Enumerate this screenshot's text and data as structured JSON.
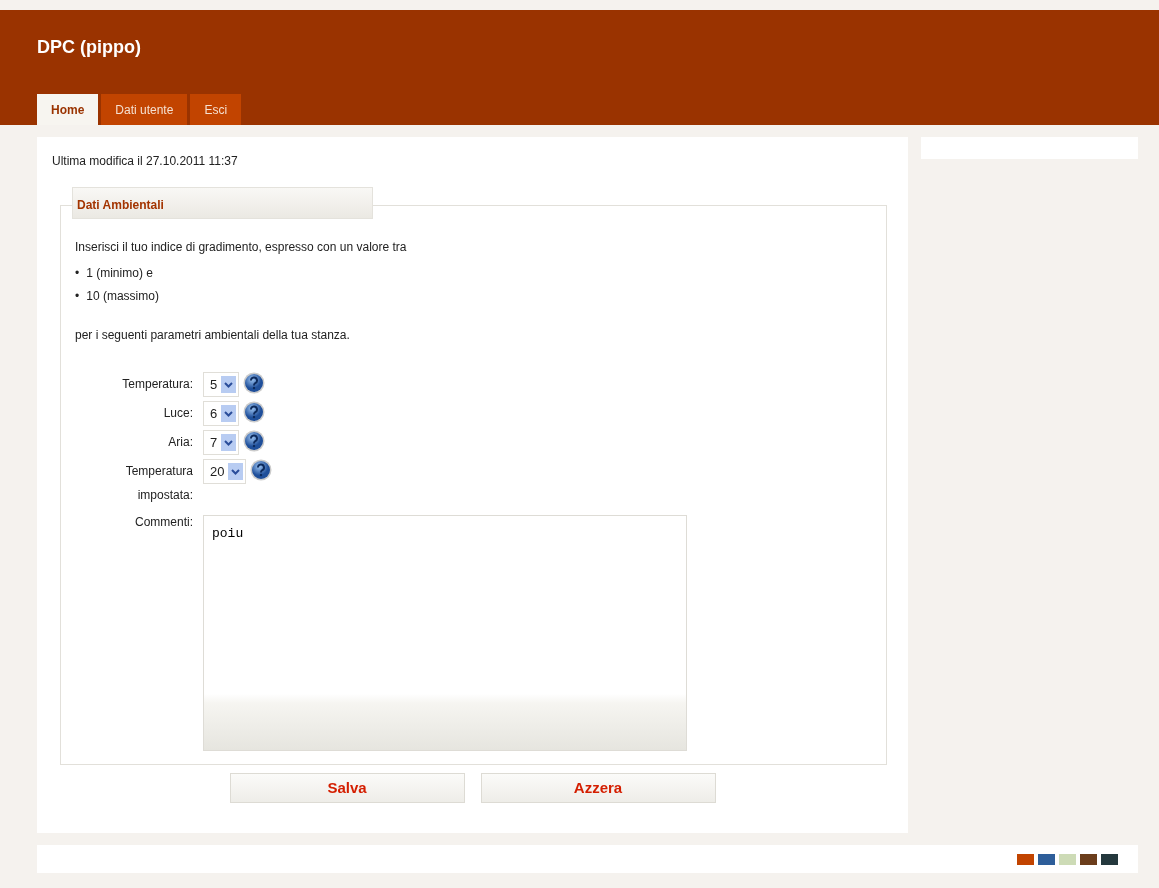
{
  "header": {
    "title": "DPC (pippo)"
  },
  "tabs": [
    {
      "label": "Home",
      "selected": true
    },
    {
      "label": "Dati utente",
      "selected": false
    },
    {
      "label": "Esci",
      "selected": false
    }
  ],
  "last_modified": "Ultima modifica il 27.10.2011 11:37",
  "fieldset": {
    "legend": "Dati Ambientali",
    "intro": "Inserisci il tuo indice di gradimento, espresso con un valore tra",
    "bullets": [
      {
        "marker": "•",
        "text": "1 (minimo) e"
      },
      {
        "marker": "•",
        "text": "10 (massimo)"
      }
    ],
    "outro": "per i seguenti parametri ambientali della tua stanza.",
    "fields": [
      {
        "label": "Temperatura:",
        "value": "5"
      },
      {
        "label": "Luce:",
        "value": "6"
      },
      {
        "label": "Aria:",
        "value": "7"
      },
      {
        "label": "Temperatura impostata:",
        "value": "20"
      }
    ],
    "comments": {
      "label": "Commenti:",
      "value": "poiu"
    }
  },
  "buttons": [
    "Salva",
    "Azzera"
  ],
  "theme_swatches": [
    {
      "color": "#c24400"
    },
    {
      "color": "#2e5e9a"
    },
    {
      "color": "#cddbb6"
    },
    {
      "color": "#6b3d1b"
    },
    {
      "color": "#24383d"
    }
  ]
}
